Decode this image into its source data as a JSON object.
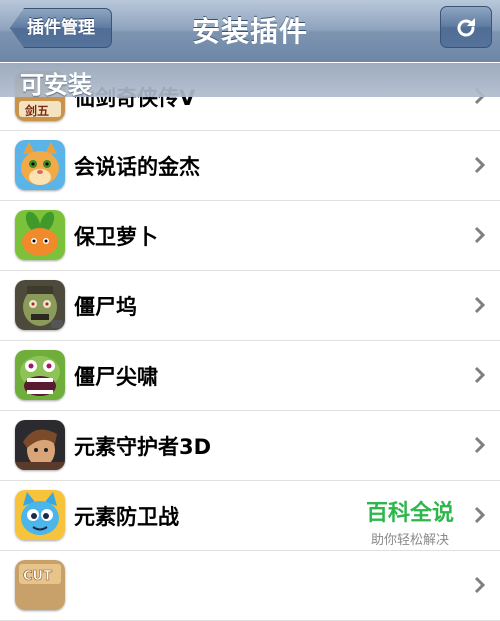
{
  "navbar": {
    "title": "安装插件",
    "back_label": "插件管理",
    "refresh_icon": "refresh-icon"
  },
  "section": {
    "header": "可安装"
  },
  "apps": [
    {
      "name": "仙剑奇侠传V",
      "icon": "sword-game-icon"
    },
    {
      "name": "会说话的金杰",
      "icon": "talking-cat-icon"
    },
    {
      "name": "保卫萝卜",
      "icon": "carrot-icon"
    },
    {
      "name": "僵尸坞",
      "icon": "zombie-icon"
    },
    {
      "name": "僵尸尖啸",
      "icon": "zombie-screaming-icon"
    },
    {
      "name": "元素守护者3D",
      "icon": "warrior-portrait-icon"
    },
    {
      "name": "元素防卫战",
      "icon": "blue-creature-icon"
    },
    {
      "name": "",
      "icon": "cut-rope-icon"
    }
  ],
  "watermark": {
    "title": "百科全说",
    "subtitle": "助你轻松解决"
  },
  "colors": {
    "navbar": "#8ea3bd",
    "watermark_green": "#2db74a"
  }
}
